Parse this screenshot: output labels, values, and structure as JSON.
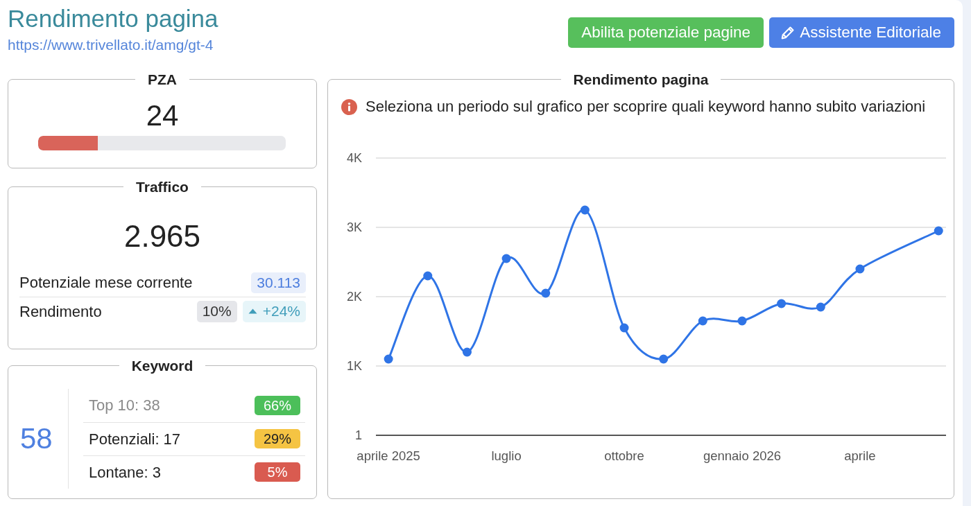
{
  "header": {
    "title": "Rendimento pagina",
    "url": "https://www.trivellato.it/amg/gt-4",
    "buttons": [
      {
        "label": "Abilita potenziale pagine",
        "kind": "enable"
      },
      {
        "label": "Assistente Editoriale",
        "kind": "assistant"
      }
    ]
  },
  "pza": {
    "title": "PZA",
    "value": "24",
    "level": 0.24
  },
  "traffico": {
    "title": "Traffico",
    "value": "2.965",
    "rows": [
      {
        "label": "Potenziale mese corrente",
        "badges": [
          {
            "text": "30.113",
            "kind": "info"
          }
        ]
      },
      {
        "label": "Rendimento",
        "badges": [
          {
            "text": "10%",
            "kind": "neutral"
          },
          {
            "text": "+24%",
            "kind": "trend-up"
          }
        ]
      }
    ]
  },
  "keyword": {
    "title": "Keyword",
    "total": "58",
    "rows": [
      {
        "label": "Top 10: 38",
        "muted": true,
        "badge": "66%",
        "color": "#4cbf5a"
      },
      {
        "label": "Potenziali: 17",
        "muted": false,
        "badge": "29%",
        "color": "#f5c443"
      },
      {
        "label": "Lontane: 3",
        "muted": false,
        "badge": "5%",
        "color": "#d95b50"
      }
    ]
  },
  "chart_panel": {
    "title": "Rendimento pagina",
    "notice": "Seleziona un periodo sul grafico per scoprire quali keyword hanno subito variazioni",
    "chart_data": {
      "type": "line",
      "categories": [
        "aprile 2025",
        null,
        null,
        "luglio",
        null,
        null,
        "ottobre",
        null,
        null,
        "gennaio 2026",
        null,
        null,
        "aprile",
        null,
        null
      ],
      "series": [
        {
          "color": "#2f74e6",
          "marker": true,
          "values": [
            1100,
            2300,
            1200,
            2550,
            2050,
            3250,
            1550,
            1100,
            1650,
            1650,
            1900,
            1850,
            2400,
            null,
            2950
          ]
        }
      ],
      "ylim": [
        0,
        4000
      ],
      "yticks": [
        {
          "value": 1,
          "label": "1"
        },
        {
          "value": 1000,
          "label": "1K"
        },
        {
          "value": 2000,
          "label": "2K"
        },
        {
          "value": 3000,
          "label": "3K"
        },
        {
          "value": 4000,
          "label": "4K"
        }
      ],
      "grid": true
    }
  }
}
